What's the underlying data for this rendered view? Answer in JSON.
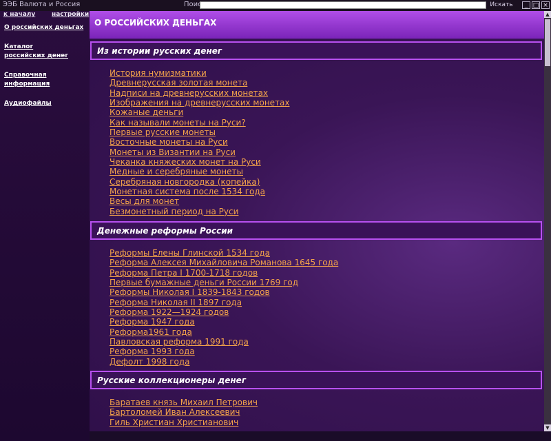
{
  "topbar": {
    "app_title": "ЭЭБ Валюта и Россия",
    "search_label": "Поиск",
    "search_value": "",
    "find_label": "Искать",
    "minimize": "_",
    "maximize": "□",
    "close": "×"
  },
  "sidebar": {
    "home": "к началу",
    "settings": "настройки",
    "items": [
      {
        "label": "О российских деньгах"
      },
      {
        "label": "Каталог российских денег"
      },
      {
        "label": "Справочная информация"
      },
      {
        "label": "Аудиофайлы"
      }
    ]
  },
  "main": {
    "title": "О РОССИЙСКИХ ДЕНЬГАХ",
    "sections": [
      {
        "title": "Из истории русских денег",
        "links": [
          "История нумизматики",
          "Древнерусская золотая монета",
          "Надписи на древнерусских монетах",
          "Изображения на древнерусских монетах",
          "Кожаные деньги",
          "Как называли монеты на Руси?",
          "Первые русские монеты",
          "Восточные монеты на Руси",
          "Монеты из Византии на Руси",
          "Чеканка княжеских монет на Руси",
          "Медные и серебряные монеты",
          "Серебряная новгородка (копейка)",
          "Монетная система после 1534 года",
          "Весы для монет",
          "Безмонетный период на Руси"
        ]
      },
      {
        "title": "Денежные реформы России",
        "links": [
          "Реформы Елены Глинской 1534 года",
          "Реформа Алексея Михайловича Романова 1645 года",
          "Реформа Петра I 1700-1718 годов",
          "Первые бумажные деньги России 1769 год",
          "Реформы Николая I 1839-1843 годов",
          "Реформа Николая II 1897 года",
          "Реформа 1922—1924 годов",
          "Реформа 1947 года",
          "Реформа1961 года",
          "Павловская реформа 1991 года",
          "Реформа 1993 года",
          "Дефолт 1998 года"
        ]
      },
      {
        "title": "Русские коллекционеры денег",
        "links": [
          "Баратаев князь Михаил Петрович",
          "Бартоломей Иван Алексеевич",
          "Гиль Христиан Христианович"
        ]
      }
    ]
  },
  "colors": {
    "link": "#f2a24a",
    "header": "#9a3ad6",
    "section_border": "#b850f0",
    "background": "#2e0f48"
  }
}
